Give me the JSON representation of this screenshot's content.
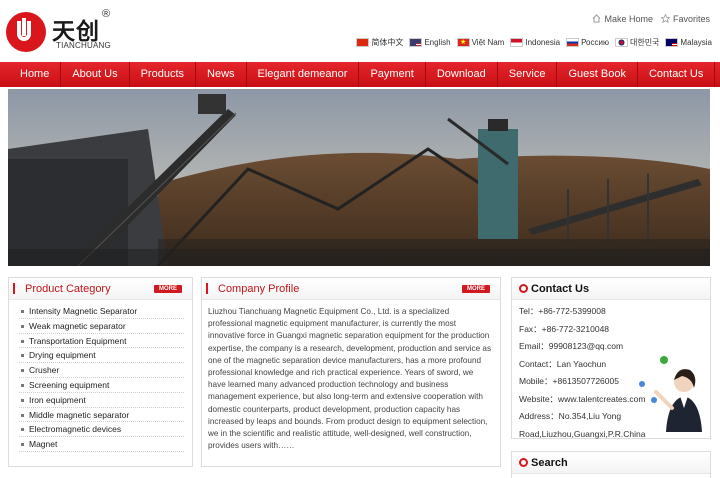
{
  "header": {
    "logo_cn": "天创",
    "logo_reg": "®",
    "logo_en": "TIANCHUANG",
    "make_home": "Make Home",
    "favorites": "Favorites",
    "languages": [
      "简体中文",
      "English",
      "Việt Nam",
      "Indonesia",
      "Россию",
      "대한민국",
      "Malaysia"
    ]
  },
  "nav": {
    "items": [
      "Home",
      "About Us",
      "Products",
      "News",
      "Elegant demeanor",
      "Payment",
      "Download",
      "Service",
      "Guest Book",
      "Contact Us"
    ]
  },
  "category": {
    "title": "Product Category",
    "more": "MORE",
    "items": [
      "Intensity Magnetic Separator",
      "Weak magnetic separator",
      "Transportation Equipment",
      "Drying equipment",
      "Crusher",
      "Screening equipment",
      "Iron equipment",
      "Middle magnetic separator",
      "Electromagnetic devices",
      "Magnet"
    ]
  },
  "profile": {
    "title": "Company Profile",
    "more": "MORE",
    "text": "Liuzhou Tianchuang Magnetic Equipment Co., Ltd. is a specialized professional magnetic equipment manufacturer, is currently the most innovative force in Guangxi magnetic separation equipment for the production expertise, the company is a research, development, production and service as one of the magnetic separation device manufacturers, has a more profound professional knowledge and rich practical experience. Years of sword, we have learned many advanced production technology and business management experience, but also long-term and extensive cooperation with domestic counterparts, product development, production capacity has increased by leaps and bounds. From product design to equipment selection, we in the scientific and realistic attitude, well-designed, well construction, provides users with……"
  },
  "contact": {
    "title": "Contact Us",
    "rows": [
      "Tel：+86-772-5399008",
      "Fax：+86-772-3210048",
      "Email：99908123@qq.com",
      "Contact：Lan Yaochun",
      "Mobile：+8613507726005",
      "Website：www.talentcreates.com",
      "Address：No.354,Liu Yong",
      "Road,Liuzhou,Guangxi,P.R.China"
    ]
  },
  "search": {
    "title": "Search"
  },
  "colors": {
    "brand_red": "#d8161c",
    "nav_red": "#d8141a"
  }
}
